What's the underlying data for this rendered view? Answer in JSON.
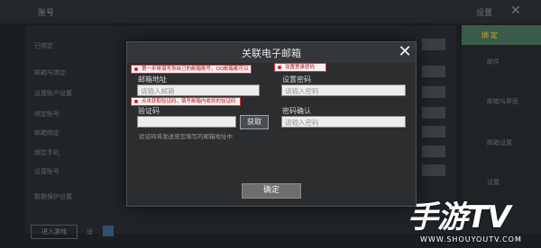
{
  "background": {
    "title": "账号",
    "settings_label": "设置",
    "close_glyph": "✕",
    "rows": [
      "已绑定",
      "邮箱与绑定",
      "设置账户设置",
      "绑定账号",
      "邮箱绑定",
      "绑定手机",
      "设置账号",
      "数据保护设置"
    ],
    "sidebar_active_label": "绑定",
    "sidebar_items": [
      "邮件",
      "邮箱与界面",
      "邮箱设置",
      "设置"
    ],
    "bottom_button": "进入游戏",
    "bottom_label": "设"
  },
  "dialog": {
    "title": "关联电子邮箱",
    "close_glyph": "✕",
    "email_label": "邮箱地址",
    "email_placeholder": "请输入邮箱",
    "code_label": "验证码",
    "code_placeholder": "",
    "get_code_button": "获取",
    "password_label": "设置密码",
    "password_placeholder": "请输入密码",
    "confirm_label": "密码确认",
    "confirm_placeholder": "请输入密码",
    "hint": "验证码将发送至您填写的邮箱地址中",
    "confirm_button": "确定"
  },
  "annotations": {
    "first": "第一步将填写你自己的邮箱账号，QQ邮箱都可以",
    "second": "点击获取验证码，填写邮箱内收到的验证码",
    "third": "设置登录密码"
  },
  "watermark": {
    "brand": "手游TV",
    "url": "WWW.SHOUYOUTV.COM"
  },
  "colors": {
    "annotation_border": "#e0303a",
    "dialog_bg": "#2b2d2f",
    "sidebar_active": "#3c5a49"
  }
}
